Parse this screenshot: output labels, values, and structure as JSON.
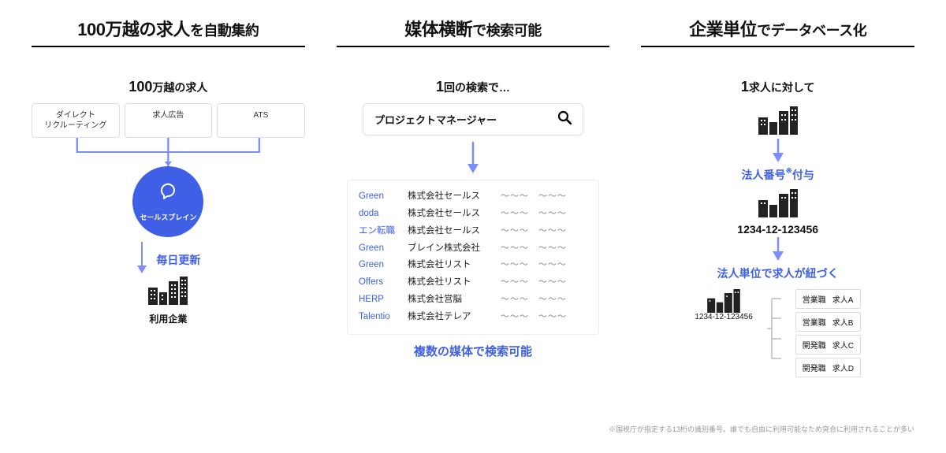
{
  "col1": {
    "title_bold": "100万越の求人",
    "title_rest": "を自動集約",
    "subtitle_big": "100",
    "subtitle_rest": "万越の求人",
    "sources": [
      "ダイレクト\nリクルーティング",
      "求人広告",
      "ATS"
    ],
    "brain_label": "セールスブレイン",
    "update_label": "毎日更新",
    "caption": "利用企業"
  },
  "col2": {
    "title_bold": "媒体横断",
    "title_rest": "で検索可能",
    "subtitle_big": "1",
    "subtitle_rest": "回の検索で…",
    "search_term": "プロジェクトマネージャー",
    "results": [
      {
        "media": "Green",
        "company": "株式会社セールス",
        "tail": "～～～　～～～"
      },
      {
        "media": "doda",
        "company": "株式会社セールス",
        "tail": "～～～　～～～"
      },
      {
        "media": "エン転職",
        "company": "株式会社セールス",
        "tail": "～～～　～～～"
      },
      {
        "media": "Green",
        "company": "ブレイン株式会社",
        "tail": "～～～　～～～"
      },
      {
        "media": "Green",
        "company": "株式会社リスト",
        "tail": "～～～　～～～"
      },
      {
        "media": "Offers",
        "company": "株式会社リスト",
        "tail": "～～～　～～～"
      },
      {
        "media": "HERP",
        "company": "株式会社営脳",
        "tail": "～～～　～～～"
      },
      {
        "media": "Talentio",
        "company": "株式会社テレア",
        "tail": "～～～　～～～"
      }
    ],
    "caption": "複数の媒体で検索可能"
  },
  "col3": {
    "title_bold": "企業単位",
    "title_rest": "でデータベース化",
    "subtitle_big": "1",
    "subtitle_rest": "求人に対して",
    "step1": "法人番号",
    "step1_suffix": "付与",
    "number": "1234-12-123456",
    "step2": "法人単位で求人が紐づく",
    "mini_number": "1234-12-123456",
    "jobs": [
      {
        "role": "営業職",
        "name": "求人A"
      },
      {
        "role": "営業職",
        "name": "求人B"
      },
      {
        "role": "開発職",
        "name": "求人C"
      },
      {
        "role": "開発職",
        "name": "求人D"
      }
    ]
  },
  "footnote": "※国税庁が指定する13桁の識別番号。誰でも自由に利用可能なため突合に利用されることが多い"
}
